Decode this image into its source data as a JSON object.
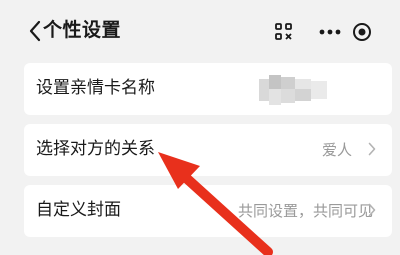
{
  "header": {
    "back_icon": "chevron-left-icon",
    "title": "个性设置",
    "icons": [
      "scan-icon",
      "more-icon",
      "record-icon"
    ]
  },
  "settings": {
    "rows": [
      {
        "label": "设置亲情卡名称",
        "value": ""
      },
      {
        "label": "选择对方的关系",
        "value": "爱人"
      },
      {
        "label": "自定义封面",
        "value": "共同设置，共同可见"
      }
    ]
  },
  "annotation": {
    "arrow_color": "#e8301c"
  }
}
